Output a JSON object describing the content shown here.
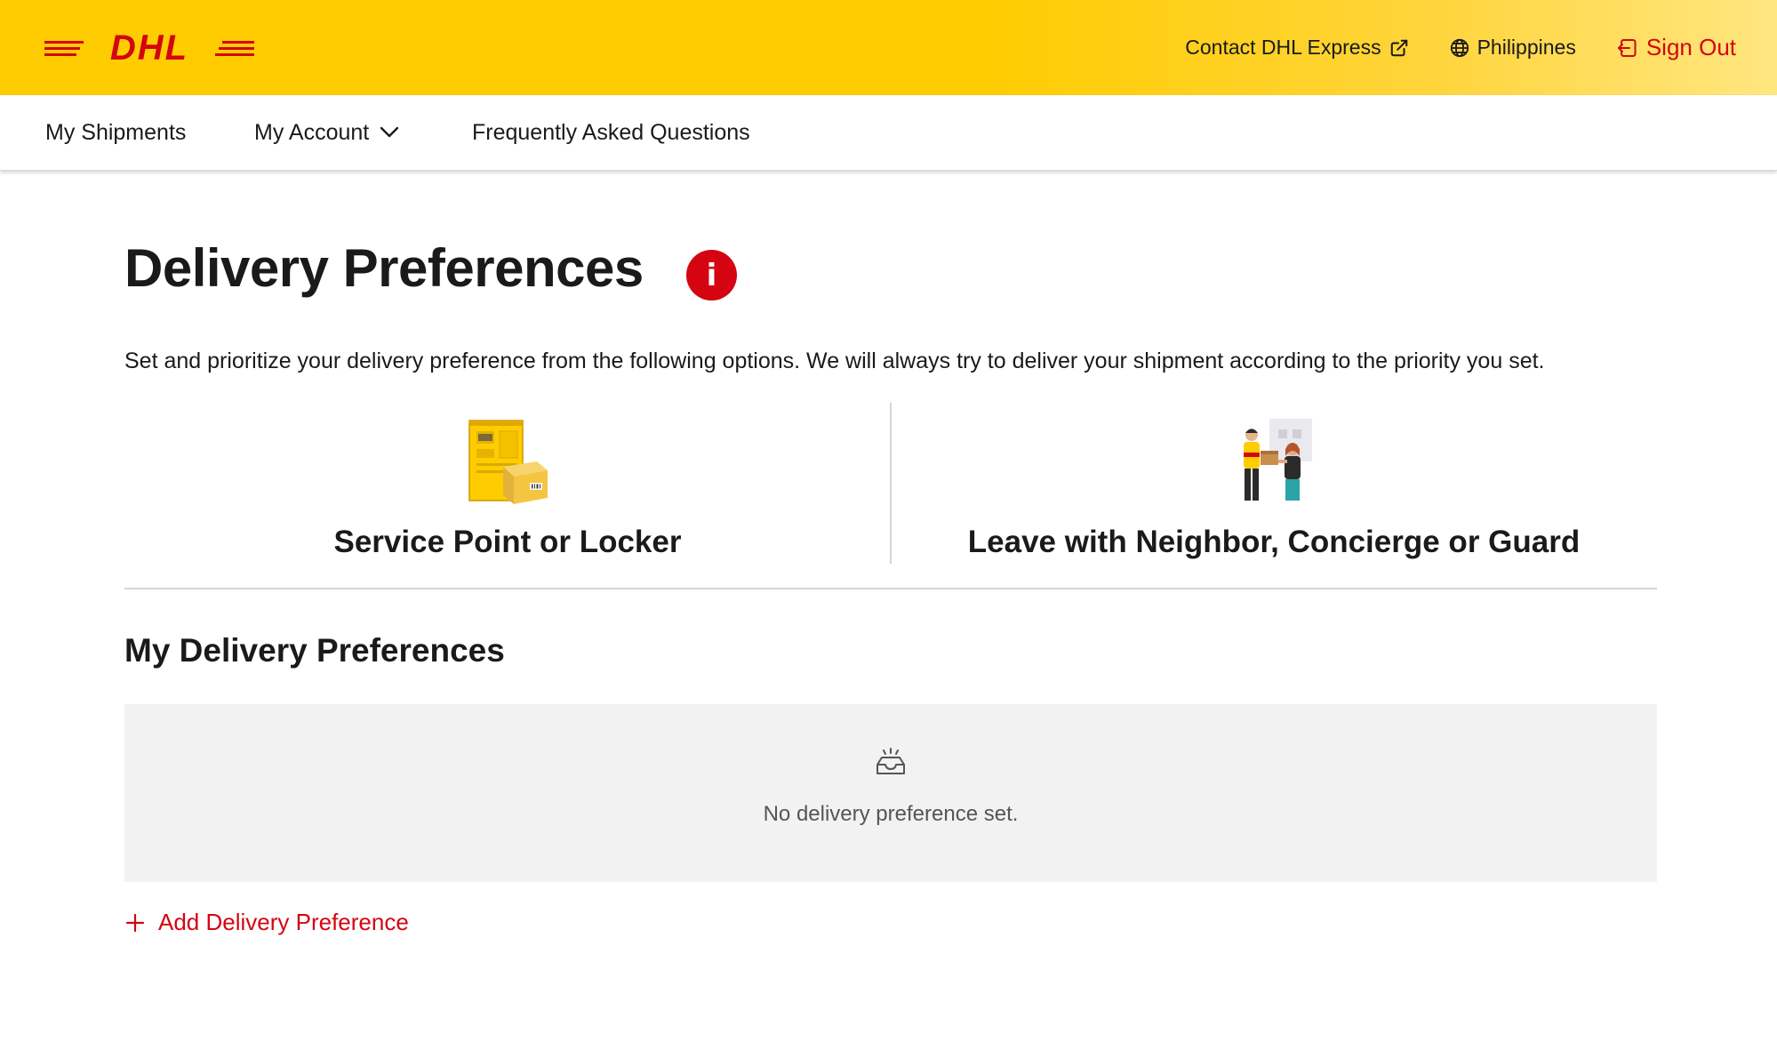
{
  "header": {
    "logo_text": "DHL",
    "contact_label": "Contact DHL Express",
    "country_label": "Philippines",
    "signout_label": "Sign Out",
    "brand_yellow": "#FFCC00",
    "brand_red": "#D40511"
  },
  "nav": {
    "items": [
      {
        "label": "My Shipments"
      },
      {
        "label": "My Account",
        "icon": "chevron-down-icon"
      },
      {
        "label": "Frequently Asked Questions"
      }
    ]
  },
  "main": {
    "title": "Delivery Preferences",
    "info_icon": "info-icon",
    "intro": "Set and prioritize your delivery preference from the following options. We will always try to deliver your shipment according to the priority you set.",
    "options": [
      {
        "label": "Service Point or Locker",
        "icon": "locker-illustration"
      },
      {
        "label": "Leave with Neighbor, Concierge or Guard",
        "icon": "neighbor-handover-illustration"
      }
    ],
    "my_prefs": {
      "title": "My Delivery Preferences",
      "empty_icon": "empty-tray-icon",
      "empty_text": "No delivery preference set.",
      "add_label": "Add Delivery Preference"
    }
  }
}
